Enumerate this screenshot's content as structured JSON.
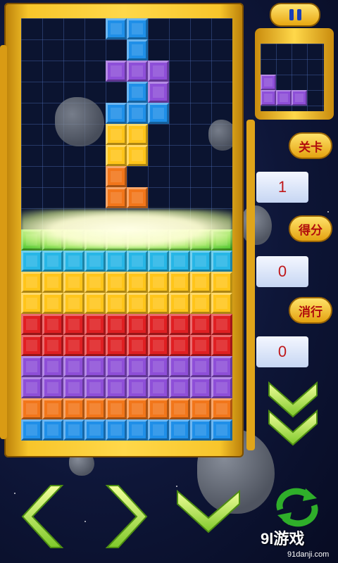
{
  "hud": {
    "level_label": "关卡",
    "level_value": "1",
    "score_label": "得分",
    "score_value": "0",
    "lines_label": "消行",
    "lines_value": "0"
  },
  "watermark": {
    "main": "9l游戏",
    "sub": "91danji.com"
  },
  "colors": {
    "blue": "#1f8fe8",
    "cyan": "#27b6e6",
    "purple": "#8e4fd8",
    "yellow": "#ffc51a",
    "orange": "#f2761a",
    "red": "#e01f22",
    "green": "#47c42a"
  },
  "board": {
    "cols": 10,
    "rows": 20,
    "falling": [
      [
        4,
        0,
        "blue"
      ],
      [
        5,
        0,
        "blue"
      ],
      [
        5,
        1,
        "blue"
      ],
      [
        4,
        2,
        "purple"
      ],
      [
        5,
        2,
        "purple"
      ],
      [
        6,
        2,
        "purple"
      ],
      [
        6,
        3,
        "purple"
      ],
      [
        5,
        3,
        "blue"
      ],
      [
        4,
        4,
        "blue"
      ],
      [
        5,
        4,
        "blue"
      ],
      [
        6,
        4,
        "blue"
      ],
      [
        4,
        5,
        "yellow"
      ],
      [
        5,
        5,
        "yellow"
      ],
      [
        4,
        6,
        "yellow"
      ],
      [
        5,
        6,
        "yellow"
      ],
      [
        4,
        7,
        "orange"
      ],
      [
        4,
        8,
        "orange"
      ],
      [
        5,
        8,
        "orange"
      ]
    ],
    "clearing_row": [
      "green",
      "green",
      "green",
      "green",
      "green",
      "green",
      "green",
      "green",
      "green",
      "green"
    ],
    "stack_rows": [
      "cyan",
      "yellow",
      "yellow",
      "red",
      "red",
      "purple",
      "purple",
      "orange",
      "blue"
    ]
  },
  "next_piece": [
    [
      0,
      2,
      "purple"
    ],
    [
      0,
      3,
      "purple"
    ],
    [
      1,
      3,
      "purple"
    ],
    [
      2,
      3,
      "purple"
    ]
  ]
}
